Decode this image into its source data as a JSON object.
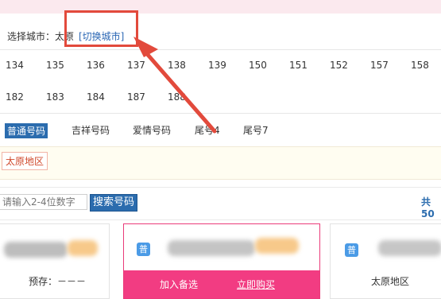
{
  "city": {
    "label": "选择城市：太原",
    "switch": "[切换城市]"
  },
  "prefixes": [
    "134",
    "135",
    "136",
    "137",
    "138",
    "139",
    "150",
    "151",
    "152",
    "157",
    "158",
    "182",
    "183",
    "184",
    "187",
    "188"
  ],
  "tabs": [
    "普通号码",
    "吉祥号码",
    "爱情号码",
    "尾号4",
    "尾号7"
  ],
  "region": "太原地区",
  "search": {
    "placeholder": "请输入2-4位数字",
    "button": "搜索号码"
  },
  "total": "共50",
  "cards": [
    {
      "deposit": "预存：－－－"
    },
    {
      "badge": "普",
      "add": "加入备选",
      "buy": "立即购买"
    },
    {
      "badge": "普",
      "region": "太原地区"
    }
  ],
  "colors": {
    "accent": "#2b6cae",
    "pink": "#f23c82",
    "annotation": "#e24a3c"
  }
}
